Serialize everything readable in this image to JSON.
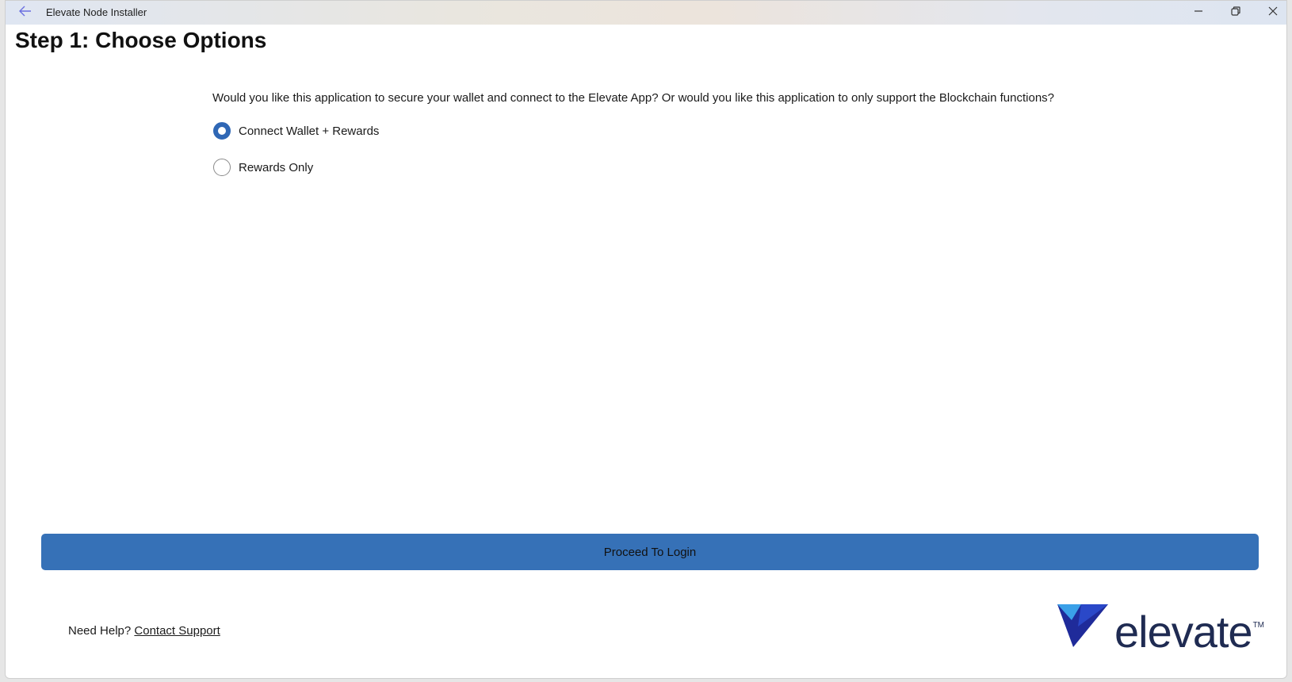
{
  "window": {
    "title": "Elevate Node Installer",
    "back_icon": "back-arrow-icon",
    "controls": [
      "minimize-icon",
      "restore-icon",
      "close-icon"
    ]
  },
  "page": {
    "title": "Step 1: Choose Options",
    "question": "Would you like this application to secure your wallet and connect to the Elevate App? Or would you like this application to only support the Blockchain functions?"
  },
  "options": {
    "selected": "Connect Wallet + Rewards",
    "items": [
      {
        "label": "Connect Wallet + Rewards",
        "checked": true
      },
      {
        "label": "Rewards Only",
        "checked": false
      }
    ]
  },
  "actions": {
    "proceed_label": "Proceed To Login"
  },
  "footer": {
    "help_text": "Need Help?",
    "support_link": "Contact Support",
    "logo_text": "elevate",
    "logo_tm": "TM"
  },
  "colors": {
    "accent": "#3671b7",
    "radio_selected": "#2f67b5",
    "logo_navy": "#1f2b52",
    "logo_blue": "#2f6fe0"
  }
}
